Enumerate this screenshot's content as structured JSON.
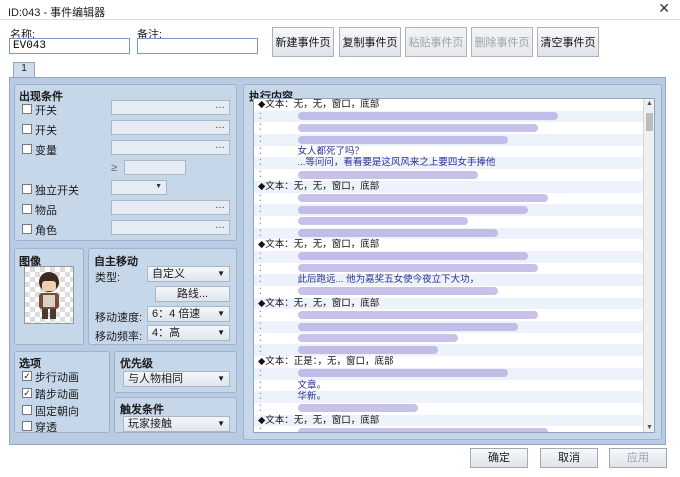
{
  "window": {
    "title": "ID:043 - 事件编辑器",
    "close_glyph": "✕"
  },
  "name": {
    "label": "名称:",
    "value": "EV043"
  },
  "note": {
    "label": "备注:",
    "value": ""
  },
  "top_buttons": [
    {
      "label": "新建事件页",
      "enabled": true
    },
    {
      "label": "复制事件页",
      "enabled": true
    },
    {
      "label": "粘贴事件页",
      "enabled": false
    },
    {
      "label": "删除事件页",
      "enabled": false
    },
    {
      "label": "清空事件页",
      "enabled": true
    }
  ],
  "tab": {
    "label": "1"
  },
  "conditions": {
    "title": "出现条件",
    "items": [
      {
        "label": "开关",
        "checked": false
      },
      {
        "label": "开关",
        "checked": false
      },
      {
        "label": "变量",
        "checked": false
      },
      {
        "label": "独立开关",
        "checked": false
      },
      {
        "label": "物品",
        "checked": false
      },
      {
        "label": "角色",
        "checked": false
      }
    ],
    "ge_symbol": "≥"
  },
  "image": {
    "title": "图像"
  },
  "autonomous": {
    "title": "自主移动",
    "type_label": "类型:",
    "type_value": "自定义",
    "route_button": "路线...",
    "speed_label": "移动速度:",
    "speed_value": "6：4 倍速",
    "freq_label": "移动频率:",
    "freq_value": "4：高"
  },
  "options": {
    "title": "选项",
    "items": [
      {
        "label": "步行动画",
        "checked": true
      },
      {
        "label": "踏步动画",
        "checked": true
      },
      {
        "label": "固定朝向",
        "checked": false
      },
      {
        "label": "穿透",
        "checked": false
      }
    ]
  },
  "priority": {
    "title": "优先级",
    "value": "与人物相同"
  },
  "trigger": {
    "title": "触发条件",
    "value": "玩家接触"
  },
  "contents": {
    "title": "执行内容",
    "rows": [
      {
        "text": "◆文本：无，无，窗口，底部",
        "head": true
      },
      {
        "text": "：",
        "blur": 260
      },
      {
        "text": "：",
        "blur": 240
      },
      {
        "text": "：",
        "blur": 210
      },
      {
        "text": "：",
        "visible": "女人都死了吗？"
      },
      {
        "text": "：",
        "visible": "...等问问，看看要是这风风来之上要四女手捧他"
      },
      {
        "text": "：",
        "blur": 180
      },
      {
        "text": "◆文本：无，无，窗口，底部",
        "head": true
      },
      {
        "text": "：",
        "blur": 250
      },
      {
        "text": "：",
        "blur": 230
      },
      {
        "text": "：",
        "blur": 170
      },
      {
        "text": "：",
        "blur": 200
      },
      {
        "text": "◆文本：无，无，窗口，底部",
        "head": true
      },
      {
        "text": "：",
        "blur": 230
      },
      {
        "text": "：",
        "blur": 240
      },
      {
        "text": "：",
        "visible": "此后跑远... 他为嘉奖五女使今夜立下大功，"
      },
      {
        "text": "：",
        "blur": 200
      },
      {
        "text": "◆文本：无，无，窗口，底部",
        "head": true
      },
      {
        "text": "：",
        "blur": 240
      },
      {
        "text": "：",
        "blur": 220
      },
      {
        "text": "：",
        "blur": 160
      },
      {
        "text": "：",
        "blur": 140
      },
      {
        "text": "◆文本：正是：，无，窗口，底部",
        "head": true
      },
      {
        "text": "：",
        "blur": 210
      },
      {
        "text": "：",
        "visible": "文章。"
      },
      {
        "text": "：",
        "visible": "华新。"
      },
      {
        "text": "：",
        "blur": 120
      },
      {
        "text": "◆文本：无，无，窗口，底部",
        "head": true
      },
      {
        "text": "：",
        "blur": 250
      },
      {
        "text": "：",
        "blur": 230
      }
    ]
  },
  "bottom_buttons": [
    {
      "label": "确定",
      "enabled": true
    },
    {
      "label": "取消",
      "enabled": true
    },
    {
      "label": "应用",
      "enabled": false
    }
  ]
}
